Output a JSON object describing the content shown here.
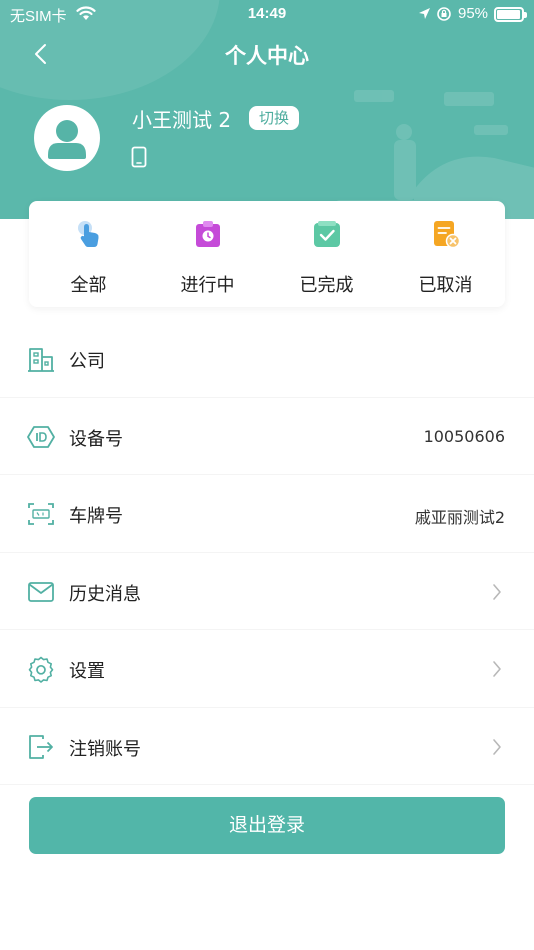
{
  "status_bar": {
    "carrier": "无SIM卡",
    "time": "14:49",
    "battery_percent": "95%",
    "battery_level": 0.95,
    "icons": [
      "wifi-icon",
      "location-arrow-icon",
      "orientation-lock-icon",
      "battery-icon"
    ]
  },
  "nav": {
    "title": "个人中心",
    "back_icon": "chevron-left-icon"
  },
  "profile": {
    "name": "小王测试 2",
    "switch_label": "切换",
    "avatar_icon": "user-avatar-icon",
    "phone_icon": "mobile-phone-icon"
  },
  "orders": [
    {
      "label": "全部",
      "icon": "pointer-hand-icon",
      "color": "#4a9ee0"
    },
    {
      "label": "进行中",
      "icon": "clipboard-clock-icon",
      "color": "#c54bd8"
    },
    {
      "label": "已完成",
      "icon": "clipboard-check-icon",
      "color": "#5cc8a4"
    },
    {
      "label": "已取消",
      "icon": "document-cancel-icon",
      "color": "#f5a623"
    }
  ],
  "menu": [
    {
      "label": "公司",
      "value": "",
      "icon": "building-icon",
      "chevron": false
    },
    {
      "label": "设备号",
      "value": "10050606",
      "icon": "id-hexagon-icon",
      "chevron": false
    },
    {
      "label": "车牌号",
      "value": "戚亚丽测试2",
      "icon": "license-plate-scan-icon",
      "chevron": false
    },
    {
      "label": "历史消息",
      "value": "",
      "icon": "mail-icon",
      "chevron": true
    },
    {
      "label": "设置",
      "value": "",
      "icon": "gear-icon",
      "chevron": true
    },
    {
      "label": "注销账号",
      "value": "",
      "icon": "exit-icon",
      "chevron": true
    }
  ],
  "logout": {
    "label": "退出登录"
  },
  "colors": {
    "brand": "#5bb8ab",
    "button": "#52b6a9",
    "icon_outline": "#52b0a3",
    "chevron": "#b8b8b8"
  }
}
